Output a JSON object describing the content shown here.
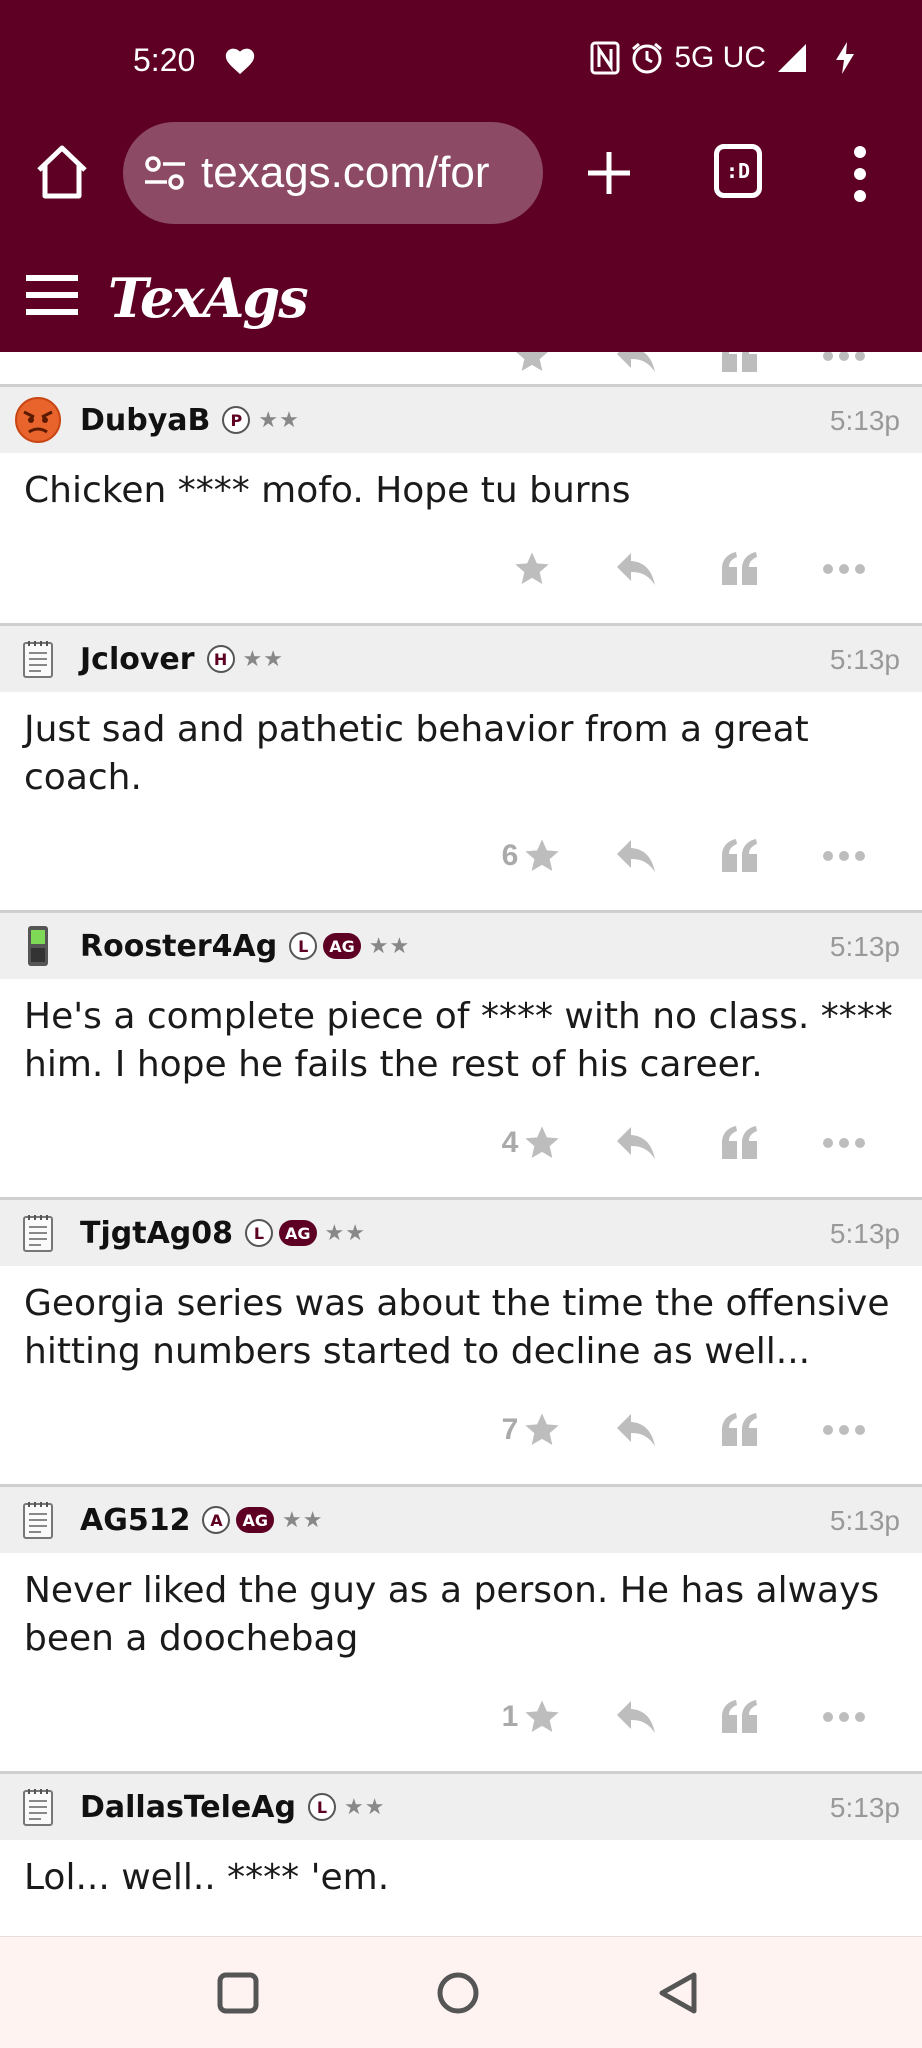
{
  "status": {
    "time": "5:20",
    "network": "5G UC"
  },
  "browser": {
    "url_main": "texags.com/for",
    "tabs_label": ":D"
  },
  "site": {
    "logo": "TexAgs"
  },
  "top_partial": {
    "visible": true
  },
  "posts": [
    {
      "user": "DubyaB",
      "badges": [
        "P"
      ],
      "ag_badge": "",
      "stars": "★★",
      "time": "5:13p",
      "body": "Chicken **** mofo. Hope tu burns",
      "likes": "",
      "avatar_icon": "angry-face-icon"
    },
    {
      "user": "Jclover",
      "badges": [
        "H"
      ],
      "ag_badge": "",
      "stars": "★★",
      "time": "5:13p",
      "body": "Just sad and pathetic behavior from a great coach.",
      "likes": "6",
      "avatar_icon": "notepad-icon"
    },
    {
      "user": "Rooster4Ag",
      "badges": [
        "L"
      ],
      "ag_badge": "AG",
      "stars": "★★",
      "time": "5:13p",
      "body": "He's a complete piece of **** with no class. **** him. I hope he fails the rest of his career.",
      "likes": "4",
      "avatar_icon": "phone-icon"
    },
    {
      "user": "TjgtAg08",
      "badges": [
        "L"
      ],
      "ag_badge": "AG",
      "stars": "★★",
      "time": "5:13p",
      "body": "Georgia series was about the time the offensive hitting numbers started to decline as well...",
      "likes": "7",
      "avatar_icon": "notepad-icon"
    },
    {
      "user": "AG512",
      "badges": [
        "A"
      ],
      "ag_badge": "AG",
      "stars": "★★",
      "time": "5:13p",
      "body": "Never liked the guy as a person. He has always been a doochebag",
      "likes": "1",
      "avatar_icon": "notepad-icon"
    },
    {
      "user": "DallasTeleAg",
      "badges": [
        "L"
      ],
      "ag_badge": "",
      "stars": "★★",
      "time": "5:13p",
      "body": "Lol... well.. **** 'em.",
      "likes": "",
      "avatar_icon": "notepad-icon"
    }
  ],
  "colors": {
    "brand": "#5d0024",
    "url_pill": "#8c4a64",
    "header_row": "#efefef",
    "action_icon": "#bdbdbd"
  }
}
